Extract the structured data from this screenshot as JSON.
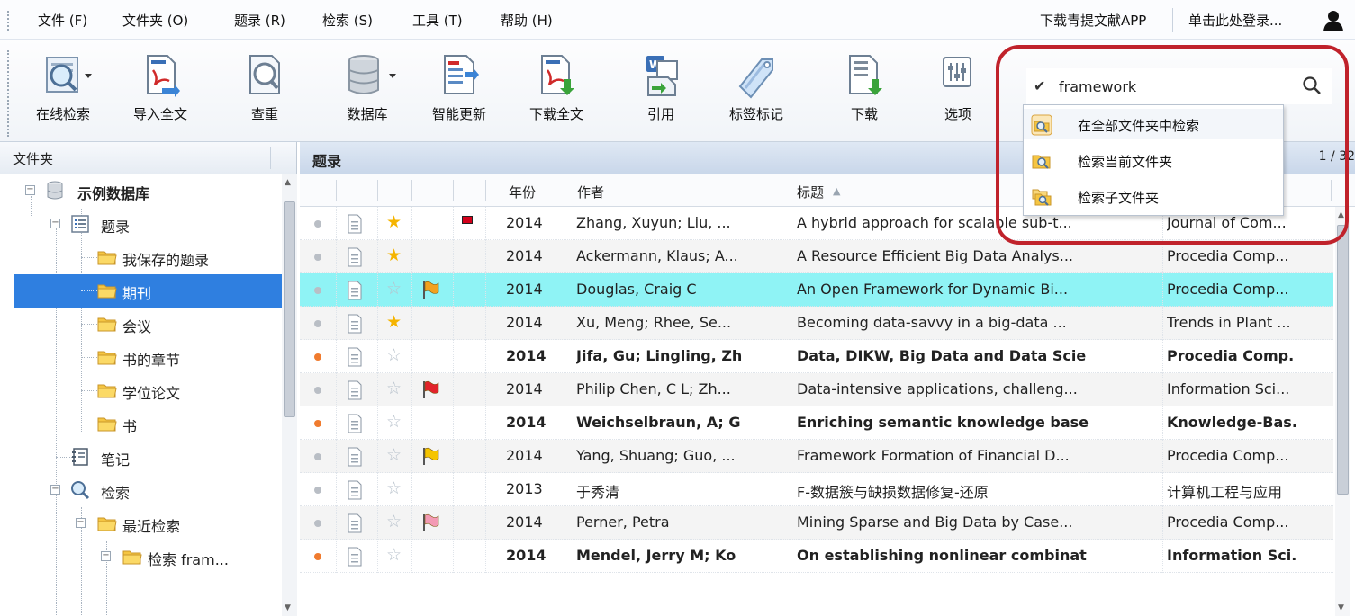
{
  "menu": {
    "items": [
      "文件 (F)",
      "文件夹 (O)",
      "题录 (R)",
      "检索 (S)",
      "工具 (T)",
      "帮助 (H)"
    ],
    "download_app": "下载青提文献APP",
    "login": "单击此处登录..."
  },
  "toolbar": {
    "buttons": [
      "在线检索",
      "导入全文",
      "查重",
      "数据库",
      "智能更新",
      "下载全文",
      "引用",
      "标签标记",
      "下载",
      "选项"
    ]
  },
  "search": {
    "value": "framework",
    "options": [
      "在全部文件夹中检索",
      "检索当前文件夹",
      "检索子文件夹"
    ]
  },
  "left_panel": {
    "title": "文件夹",
    "tree": [
      {
        "label": "示例数据库",
        "icon": "database-icon",
        "level": 0
      },
      {
        "label": "题录",
        "icon": "list-icon",
        "level": 1
      },
      {
        "label": "我保存的题录",
        "icon": "folder-icon",
        "level": 2
      },
      {
        "label": "期刊",
        "icon": "folder-icon",
        "level": 2,
        "selected": true
      },
      {
        "label": "会议",
        "icon": "folder-icon",
        "level": 2
      },
      {
        "label": "书的章节",
        "icon": "folder-icon",
        "level": 2
      },
      {
        "label": "学位论文",
        "icon": "folder-icon",
        "level": 2
      },
      {
        "label": "书",
        "icon": "folder-icon",
        "level": 2
      },
      {
        "label": "笔记",
        "icon": "notebook-icon",
        "level": 1
      },
      {
        "label": "检索",
        "icon": "search-icon",
        "level": 1
      },
      {
        "label": "最近检索",
        "icon": "folder-icon",
        "level": 2
      },
      {
        "label": "检索 fram...",
        "icon": "folder-icon",
        "level": 3
      }
    ]
  },
  "right_panel": {
    "title": "题录",
    "page_indicator": "1 / 32",
    "columns": {
      "year": "年份",
      "author": "作者",
      "title": "标题",
      "sort_arrow": "▲"
    },
    "rows": [
      {
        "year": "2014",
        "author": "Zhang, Xuyun; Liu, ...",
        "title": "A hybrid approach for scalable sub-t...",
        "journal": "Journal of Com...",
        "star": true,
        "flag": "",
        "mark": true,
        "unread": false,
        "bold": false
      },
      {
        "year": "2014",
        "author": "Ackermann, Klaus; A...",
        "title": "A Resource Efficient Big Data Analys...",
        "journal": "Procedia Comp...",
        "star": true,
        "flag": "",
        "mark": false,
        "unread": false,
        "bold": false
      },
      {
        "year": "2014",
        "author": "Douglas, Craig C",
        "title": "An Open Framework for Dynamic Bi...",
        "journal": "Procedia Comp...",
        "star": false,
        "flag": "orange",
        "mark": false,
        "unread": false,
        "bold": false,
        "selected": true
      },
      {
        "year": "2014",
        "author": "Xu, Meng; Rhee, Se...",
        "title": "Becoming data-savvy in a big-data ...",
        "journal": "Trends in Plant ...",
        "star": true,
        "flag": "",
        "mark": false,
        "unread": false,
        "bold": false
      },
      {
        "year": "2014",
        "author": "Jifa, Gu; Lingling, Zh",
        "title": "Data, DIKW, Big Data and Data Scie",
        "journal": "Procedia Comp.",
        "star": false,
        "flag": "",
        "mark": false,
        "unread": true,
        "bold": true
      },
      {
        "year": "2014",
        "author": "Philip Chen, C L; Zh...",
        "title": "Data-intensive applications, challeng...",
        "journal": "Information Sci...",
        "star": false,
        "flag": "red",
        "mark": false,
        "unread": false,
        "bold": false
      },
      {
        "year": "2014",
        "author": "Weichselbraun, A; G",
        "title": "Enriching semantic knowledge base",
        "journal": "Knowledge-Bas.",
        "star": false,
        "flag": "",
        "mark": false,
        "unread": true,
        "bold": true
      },
      {
        "year": "2014",
        "author": "Yang, Shuang; Guo, ...",
        "title": "Framework Formation of Financial D...",
        "journal": "Procedia Comp...",
        "star": false,
        "flag": "yellow",
        "mark": false,
        "unread": false,
        "bold": false
      },
      {
        "year": "2013",
        "author": "于秀清",
        "title": "F-数据簇与缺损数据修复-还原",
        "journal": "计算机工程与应用",
        "star": false,
        "flag": "",
        "mark": false,
        "unread": false,
        "bold": false
      },
      {
        "year": "2014",
        "author": "Perner, Petra",
        "title": "Mining Sparse and Big Data by Case...",
        "journal": "Procedia Comp...",
        "star": false,
        "flag": "pink",
        "mark": false,
        "unread": false,
        "bold": false
      },
      {
        "year": "2014",
        "author": "Mendel, Jerry M; Ko",
        "title": "On establishing nonlinear combinat",
        "journal": "Information Sci.",
        "star": false,
        "flag": "",
        "mark": false,
        "unread": true,
        "bold": true
      }
    ]
  },
  "colors": {
    "selection_blue": "#2f7fe0",
    "row_selected": "#8ff3f5",
    "highlight_ring": "#c0222b",
    "unread_dot": "#f07b2e",
    "star": "#f5b400"
  }
}
